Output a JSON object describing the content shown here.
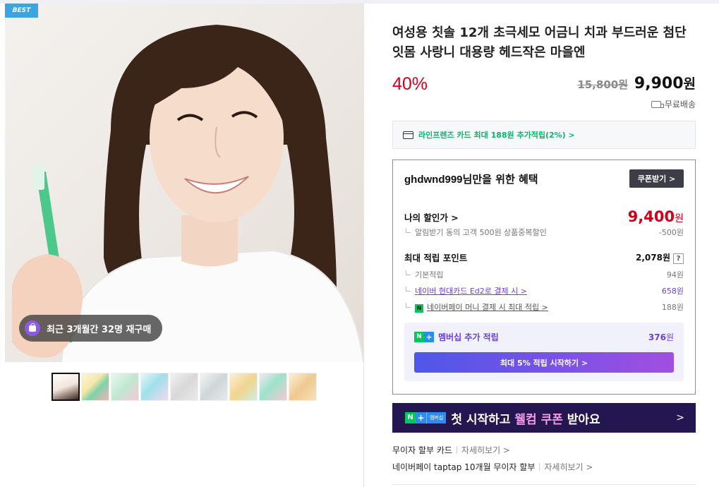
{
  "product_image": {
    "badge": "BEST",
    "repurchase_text": "최근 3개월간 32명 재구매",
    "thumbnails_count": 9
  },
  "product": {
    "title": "여성용 칫솔 12개 초극세모 어금니 치과 부드러운 첨단 잇몸 사랑니 대용량 헤드작은 마을엔",
    "discount_rate": "40%",
    "original_price": "15,800원",
    "sale_price_number": "9,900",
    "sale_price_unit": "원",
    "shipping": "무료배송"
  },
  "card_promo": {
    "text": "라인프렌즈 카드 최대 188원 추가적립(2%) >"
  },
  "benefit": {
    "nickname": "ghdwnd999",
    "header_suffix": "님만을 위한 혜택",
    "coupon_button": "쿠폰받기 >",
    "my_price_label": "나의 할인가 >",
    "my_price_number": "9,400",
    "my_price_unit": "원",
    "my_price_sub_label": "알림받기 동의 고객 500원 상품중복할인",
    "my_price_sub_value": "-500원",
    "max_points_label": "최대 적립 포인트",
    "max_points_value": "2,078원",
    "help": "?",
    "basic_label": "기본적립",
    "basic_value": "94원",
    "card_label": "네이버 현대카드 Ed2로 결제 시 >",
    "card_value": "658원",
    "npay_label": "네이버페이 머니 결제 시 최대 적립 >",
    "npay_value": "188원",
    "npay_icon": "N",
    "membership_label": "멤버십 추가 적립",
    "membership_value_number": "376",
    "membership_value_unit": "원",
    "membership_button": "최대 5% 적립 시작하기 >"
  },
  "banner": {
    "n": "N",
    "plus": "+",
    "tag": "멤버십",
    "text_before": "첫 시작하고 ",
    "text_highlight": "웰컴 쿠폰",
    "text_after": " 받아요",
    "chevron": ">"
  },
  "installments": [
    {
      "label": "무이자 할부 카드",
      "more": "자세히보기 >"
    },
    {
      "label": "네이버페이 taptap 10개월 무이자 할부",
      "more": "자세히보기 >"
    }
  ],
  "colors": {
    "discount_red": "#d0021b",
    "naver_green": "#03c75a",
    "membership_purple": "#6b3ee0",
    "banner_navy": "#241650",
    "best_badge": "#3aa5e0"
  }
}
